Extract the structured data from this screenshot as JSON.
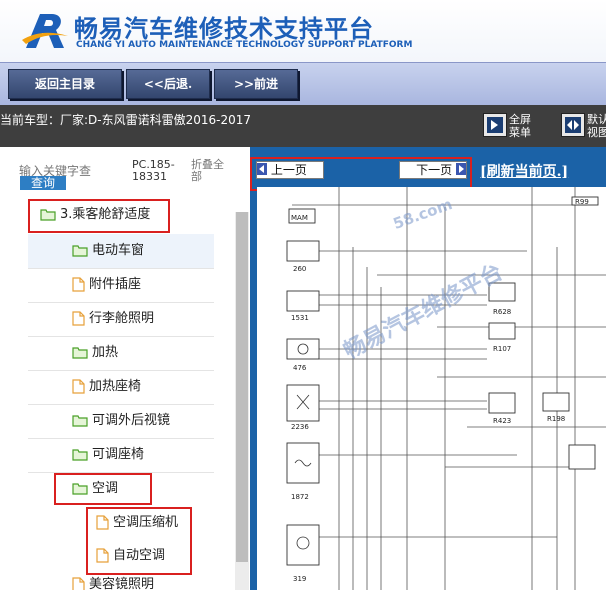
{
  "header": {
    "title_cn": "畅易汽车维修技术支持平台",
    "title_en": "CHANG YI AUTO MAINTENANCE TECHNOLOGY SUPPORT PLATFORM"
  },
  "nav": {
    "home": "返回主目录",
    "back": "<<后退.",
    "forward": ">>前进"
  },
  "info": {
    "car_label": "当前车型：",
    "car_value": "厂家:D-东风雷诺科雷傲2016-2017",
    "fullscreen_1": "全屏",
    "fullscreen_2": "菜单",
    "sync_1": "默认",
    "sync_2": "视图"
  },
  "sidebar": {
    "search_label": "输入关键字查",
    "query_button": "查询",
    "pc_1": "PC.185-",
    "pc_2": "18331",
    "fold_1": "折叠全",
    "fold_2": "部",
    "items": [
      {
        "label": "3.乘客舱舒适度",
        "type": "folder"
      },
      {
        "label": "电动车窗",
        "type": "folder"
      },
      {
        "label": "附件插座",
        "type": "file"
      },
      {
        "label": "行李舱照明",
        "type": "file"
      },
      {
        "label": "加热",
        "type": "folder"
      },
      {
        "label": "加热座椅",
        "type": "file"
      },
      {
        "label": "可调外后视镜",
        "type": "folder"
      },
      {
        "label": "可调座椅",
        "type": "folder"
      },
      {
        "label": "空调",
        "type": "folder"
      },
      {
        "label": "空调压缩机",
        "type": "file"
      },
      {
        "label": "自动空调",
        "type": "file"
      },
      {
        "label": "美容镜照明",
        "type": "file"
      }
    ]
  },
  "viewer": {
    "prev": "上一页",
    "next": "下一页",
    "refresh": "[刷新当前页.]",
    "watermark": "畅易汽车维修平台",
    "watermark_small": "58.com",
    "component_labels": [
      "MAM",
      "R99",
      "260",
      "1531",
      "R628",
      "R107",
      "476",
      "2236",
      "R423",
      "R198",
      "1872",
      "319"
    ]
  },
  "colors": {
    "brand_blue": "#1d5fb8",
    "highlight_red": "#d9201f",
    "viewer_blue": "#1b62a7"
  }
}
